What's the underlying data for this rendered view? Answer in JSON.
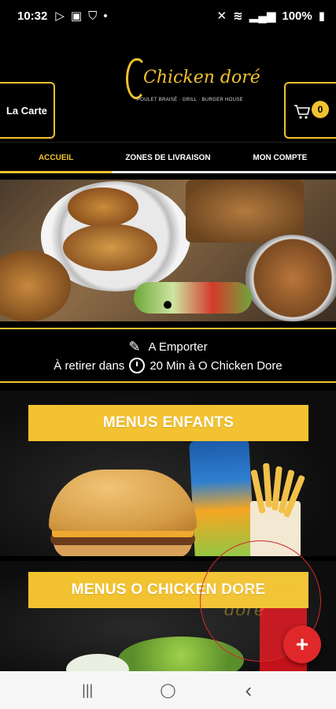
{
  "status_bar": {
    "time": "10:32",
    "battery": "100%"
  },
  "header": {
    "left_button_label": "La Carte",
    "cart_count": "0",
    "logo_text": "Chicken doré",
    "logo_subtitle": "POULET BRAISÉ · GRILL · BURGER HOUSE"
  },
  "tabs": [
    {
      "label": "ACCUEIL",
      "active": true
    },
    {
      "label": "ZONES DE LIVRAISON",
      "active": false
    },
    {
      "label": "MON COMPTE",
      "active": false
    }
  ],
  "pickup": {
    "mode": "A Emporter",
    "prefix": "À retirer dans",
    "detail": "20 Min à O Chicken Dore"
  },
  "categories": [
    {
      "label": "MENUS ENFANTS"
    },
    {
      "label": "MENUS O CHICKEN DORE"
    }
  ],
  "fab_label": "+",
  "nav": {
    "recents": "|||",
    "home": "◯",
    "back": "‹"
  },
  "colors": {
    "accent": "#f2c230",
    "fab": "#e0282a"
  }
}
